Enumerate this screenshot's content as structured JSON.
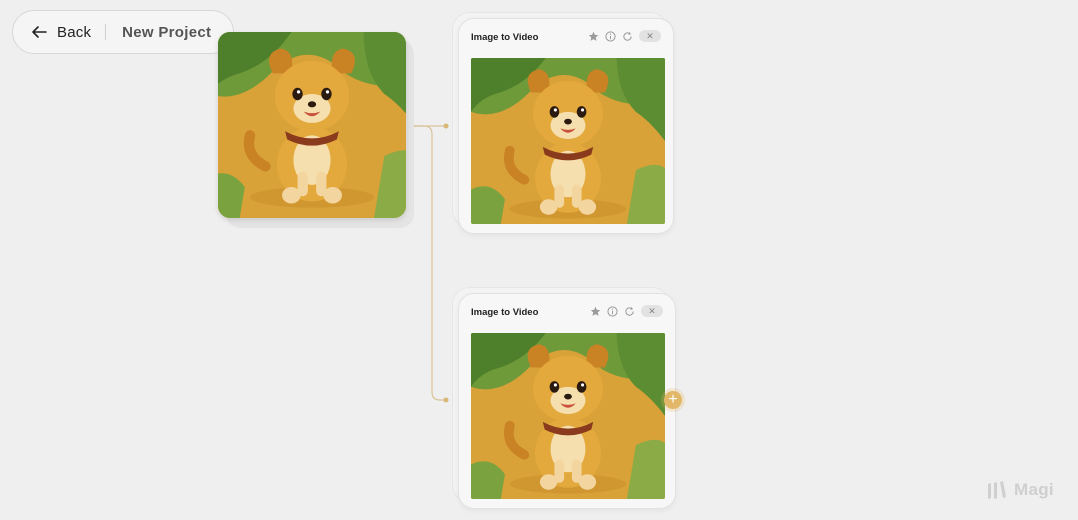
{
  "header": {
    "back_label": "Back",
    "project_title": "New Project"
  },
  "nodes": [
    {
      "title": "Image to Video",
      "icons": [
        "star-icon",
        "info-icon",
        "refresh-icon",
        "close-icon"
      ],
      "close_glyph": "✕"
    },
    {
      "title": "Image to Video",
      "icons": [
        "star-icon",
        "info-icon",
        "refresh-icon",
        "close-icon"
      ],
      "close_glyph": "✕"
    }
  ],
  "add_node": {
    "glyph": "+"
  },
  "logo": {
    "text": "Magi"
  },
  "colors": {
    "background": "#efefef",
    "accent": "#e2b868",
    "connector": "#d9c49a"
  }
}
